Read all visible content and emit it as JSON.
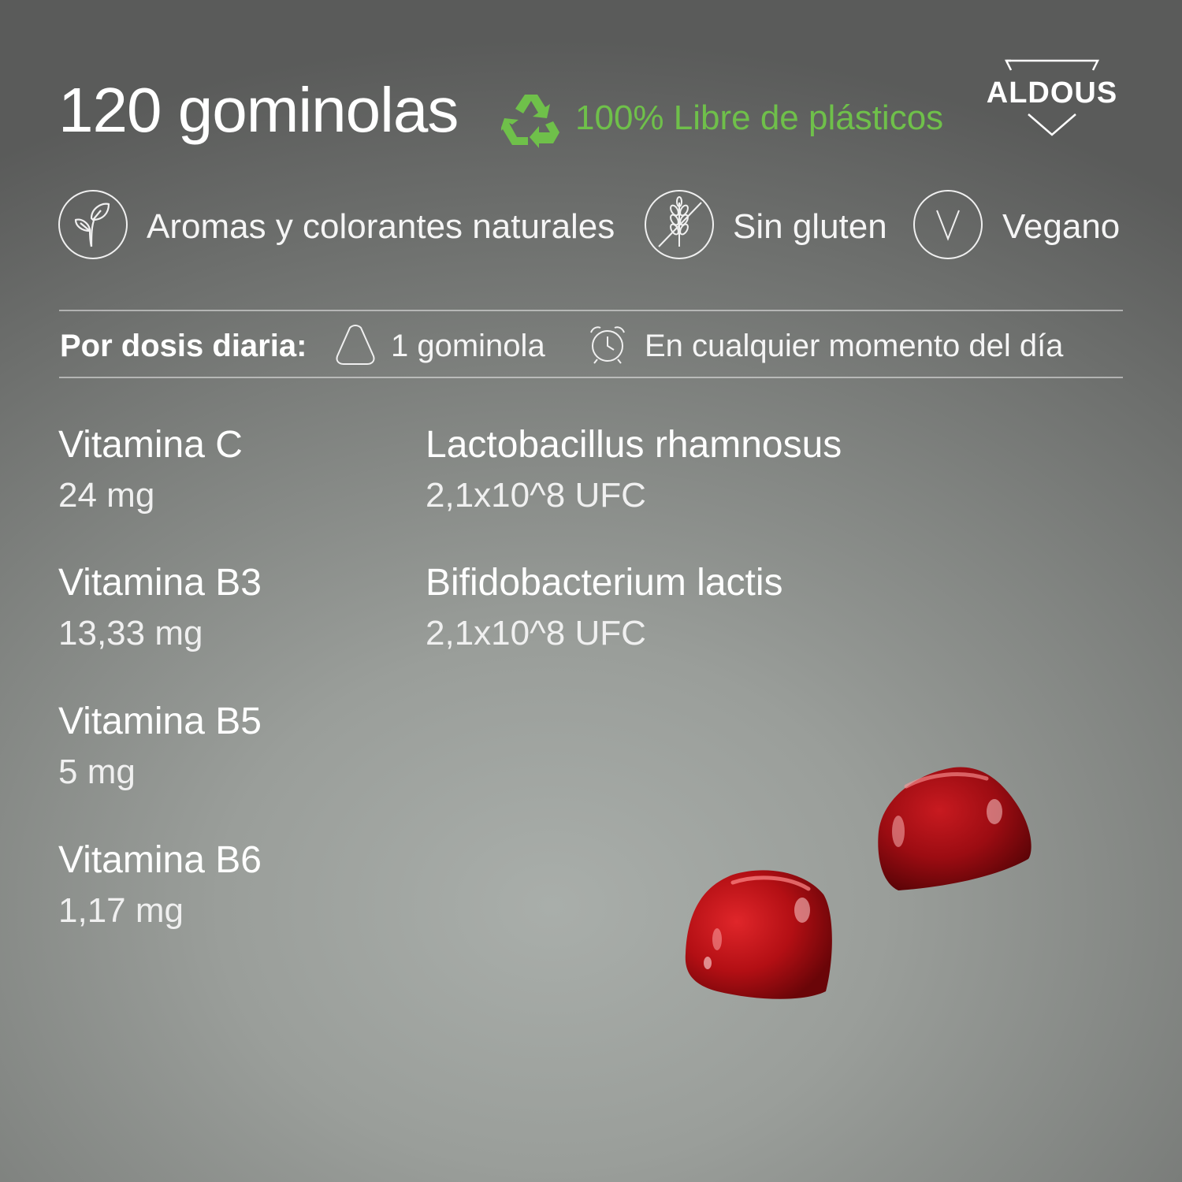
{
  "header": {
    "title": "120 gominolas",
    "plastic_free": "100% Libre de plásticos",
    "recycle_icon": "recycle-icon",
    "brand": "ALDOUS",
    "accent_color": "#6fc04a"
  },
  "badges": [
    {
      "icon": "leaf-icon",
      "label": "Aromas y colorantes naturales"
    },
    {
      "icon": "gluten-free-icon",
      "label": "Sin gluten"
    },
    {
      "icon": "vegan-icon",
      "label": "Vegano"
    }
  ],
  "dosage": {
    "label": "Por dosis diaria:",
    "amount_icon": "gummy-icon",
    "amount": "1 gominola",
    "time_icon": "alarm-clock-icon",
    "time": "En cualquier momento del día"
  },
  "nutrients_left": [
    {
      "name": "Vitamina C",
      "value": "24 mg"
    },
    {
      "name": "Vitamina B3",
      "value": "13,33 mg"
    },
    {
      "name": "Vitamina B5",
      "value": "5 mg"
    },
    {
      "name": "Vitamina B6",
      "value": "1,17 mg"
    }
  ],
  "nutrients_right": [
    {
      "name": "Lactobacillus rhamnosus",
      "value": "2,1x10^8 UFC"
    },
    {
      "name": "Bifidobacterium lactis",
      "value": "2,1x10^8 UFC"
    }
  ],
  "product_color": "#b01218"
}
